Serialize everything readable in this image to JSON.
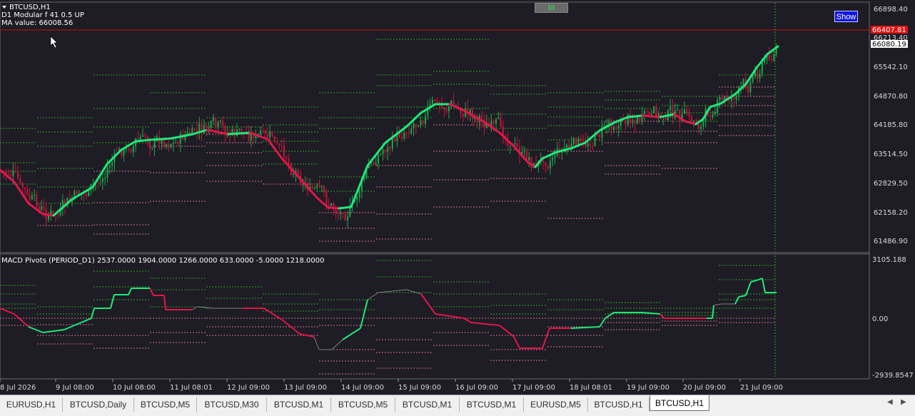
{
  "main_chart": {
    "title": "BTCUSD,H1",
    "indicator_line": "D1 Modular f 41 0.5 UP",
    "ma_value": "MA value: 66008.56",
    "price_labels": [
      "66898.40",
      "66213.40",
      "65542.10",
      "64870.80",
      "64185.80",
      "63514.50",
      "62829.50",
      "62158.20",
      "61486.90"
    ],
    "current_price_red": "66407.81",
    "current_price_white": "66080.19",
    "show_button": "Show",
    "bt_button": "bt"
  },
  "sub_chart": {
    "title": "MACD Pivots (PERIOD_D1) 2537.0000 1904.0000 1266.0000 633.0000 -5.0000 1218.0000",
    "axis_labels": [
      "3105.188",
      "0.00",
      "-2939.8547"
    ]
  },
  "time_axis": [
    "8 Jul 2026",
    "9 Jul 08:00",
    "10 Jul 08:00",
    "11 Jul 08:01",
    "12 Jul 09:00",
    "13 Jul 09:00",
    "14 Jul 09:00",
    "15 Jul 09:00",
    "16 Jul 09:00",
    "17 Jul 09:00",
    "18 Jul 08:01",
    "19 Jul 09:00",
    "20 Jul 09:00",
    "21 Jul 09:00"
  ],
  "tabs": [
    {
      "label": "EURUSD,H1",
      "active": false
    },
    {
      "label": "BTCUSD,Daily",
      "active": false
    },
    {
      "label": "BTCUSD,M5",
      "active": false
    },
    {
      "label": "BTCUSD,M30",
      "active": false
    },
    {
      "label": "BTCUSD,M1",
      "active": false
    },
    {
      "label": "BTCUSD,M5",
      "active": false
    },
    {
      "label": "BTCUSD,M1",
      "active": false
    },
    {
      "label": "BTCUSD,M1",
      "active": false
    },
    {
      "label": "EURUSD,M5",
      "active": false
    },
    {
      "label": "BTCUSD,H1",
      "active": false
    },
    {
      "label": "BTCUSD,H1",
      "active": true
    }
  ],
  "colors": {
    "background": "#1e1c24",
    "up_candle": "#1fa64a",
    "down_candle": "#c8143c",
    "ma_up": "#1ee87a",
    "ma_down": "#e0164a",
    "pivot_green": "#2aa52a",
    "pivot_pink": "#d07090",
    "price_line": "#c81010"
  },
  "chart_data": {
    "type": "line",
    "title": "BTCUSD,H1",
    "x": [
      "8 Jul 2026",
      "9 Jul 08:00",
      "10 Jul 08:00",
      "11 Jul 08:01",
      "12 Jul 09:00",
      "13 Jul 09:00",
      "14 Jul 09:00",
      "15 Jul 09:00",
      "16 Jul 09:00",
      "17 Jul 09:00",
      "18 Jul 08:01",
      "19 Jul 09:00",
      "20 Jul 09:00",
      "21 Jul 09:00"
    ],
    "series": [
      {
        "name": "MA",
        "values": [
          62400,
          62200,
          63650,
          64100,
          64000,
          62700,
          62250,
          64300,
          64550,
          63150,
          63600,
          64400,
          64200,
          66008.56
        ]
      }
    ],
    "ylim": [
      61300,
      67100
    ]
  }
}
